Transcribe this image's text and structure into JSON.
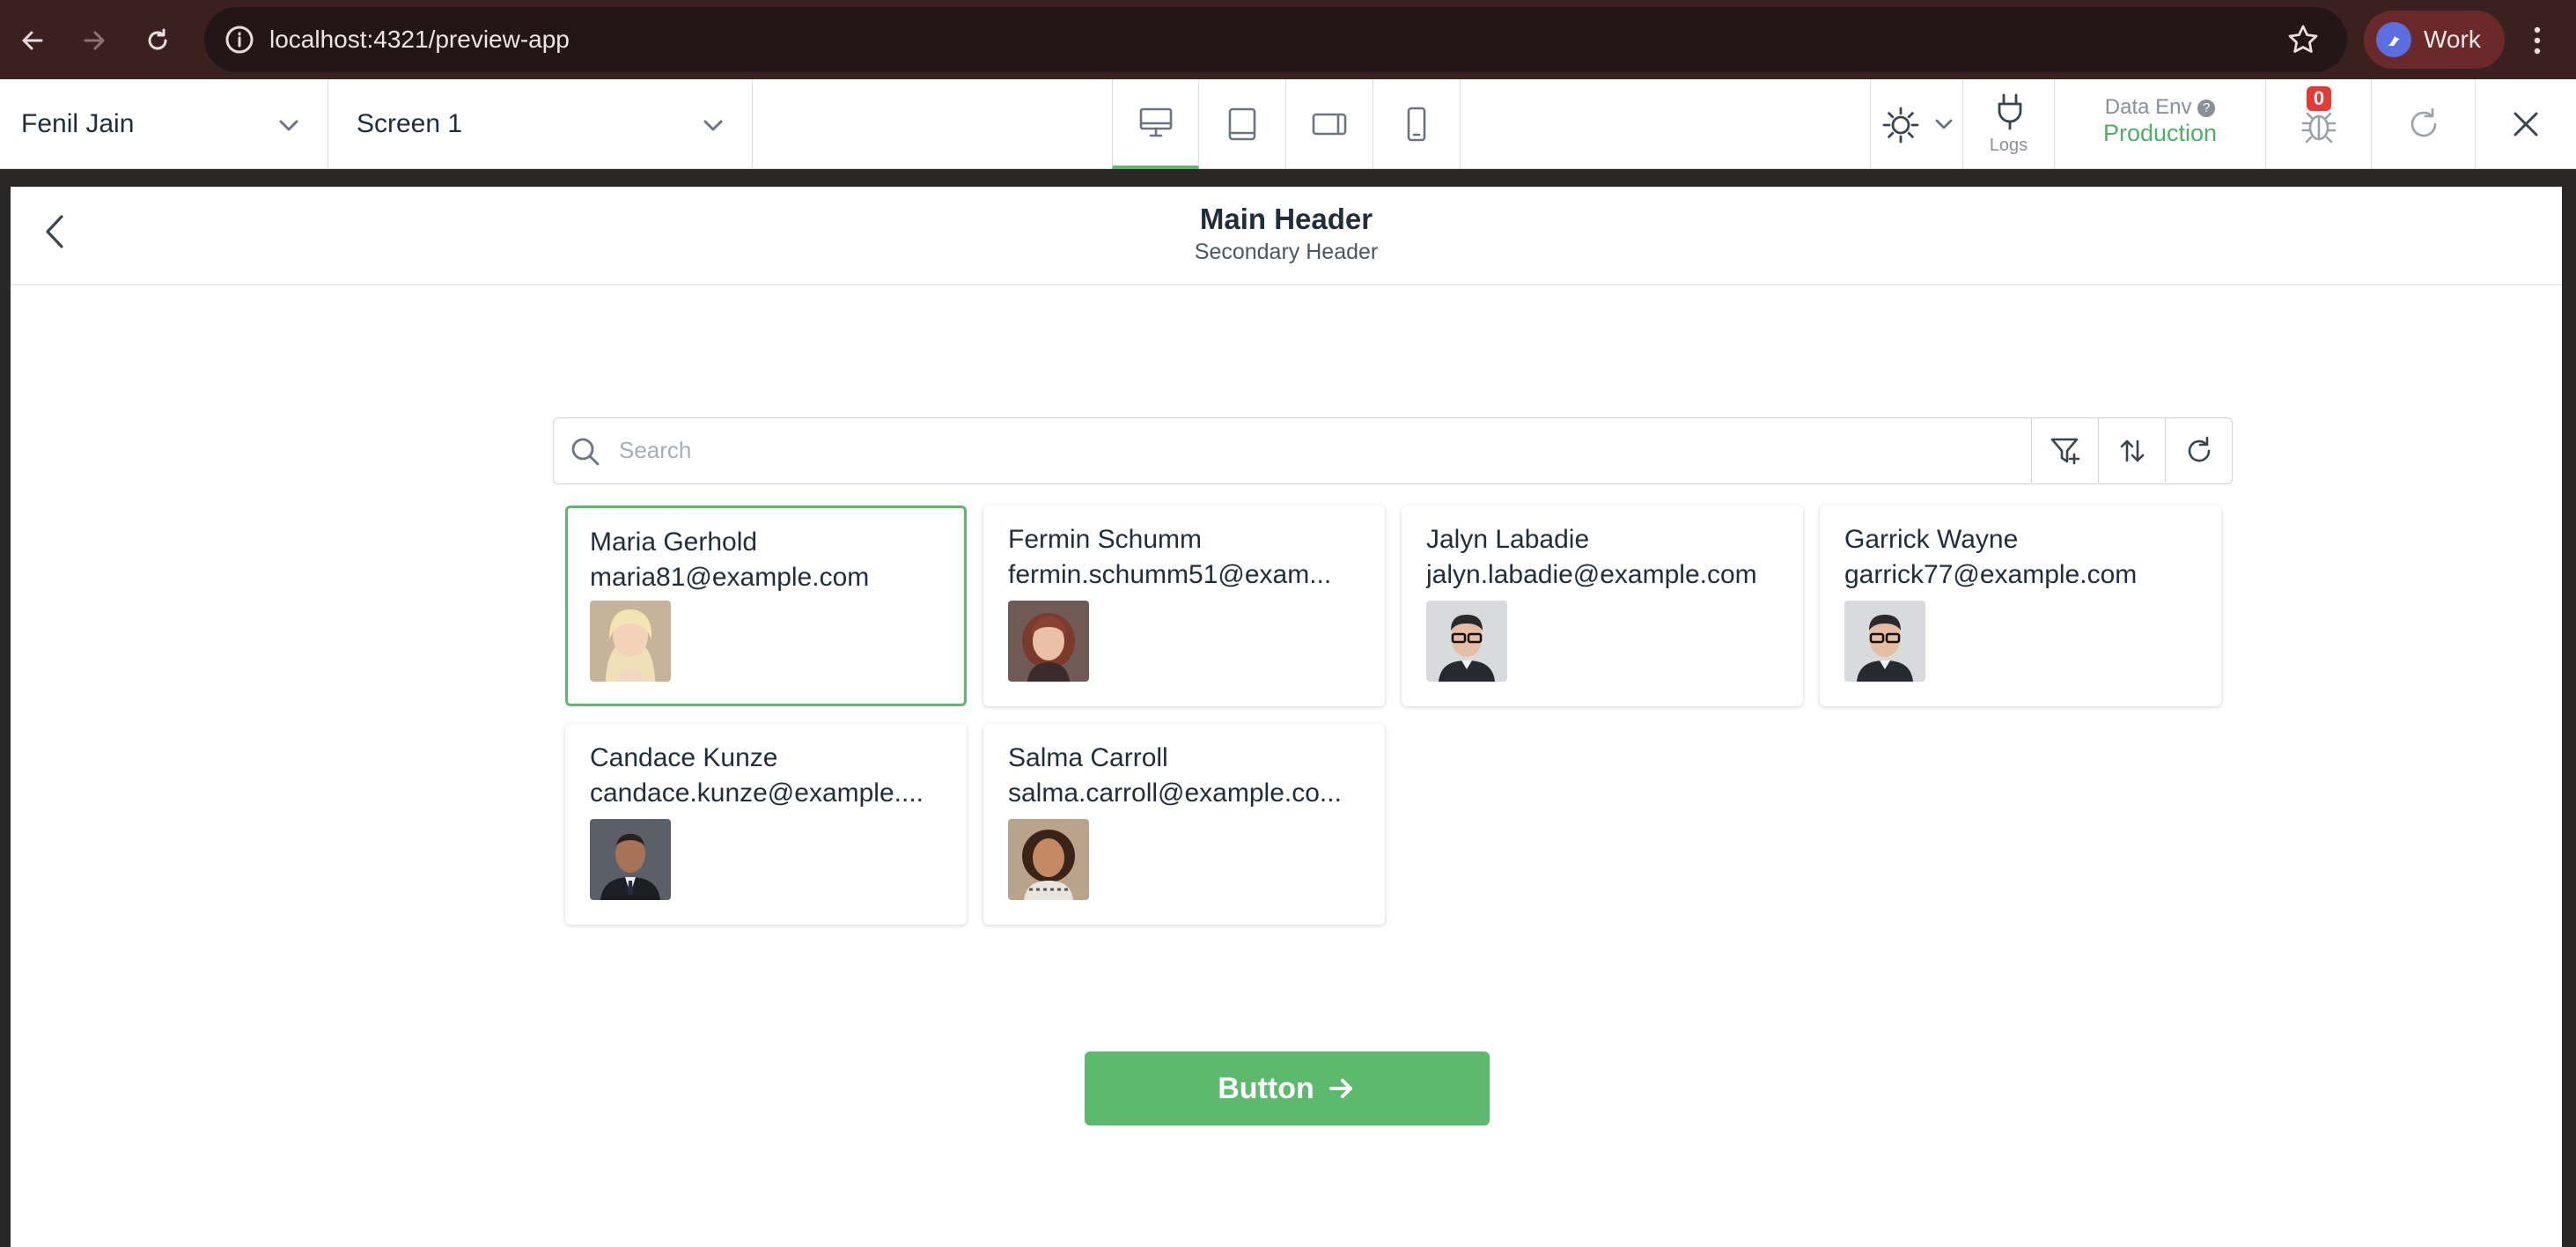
{
  "browser": {
    "url": "localhost:4321/preview-app",
    "profile_label": "Work"
  },
  "toolbar": {
    "user_select": "Fenil Jain",
    "screen_select": "Screen 1",
    "devices": [
      "desktop",
      "tablet",
      "tablet-landscape",
      "mobile"
    ],
    "active_device": "desktop",
    "logs_label": "Logs",
    "data_env_label": "Data Env",
    "data_env_value": "Production",
    "debug_badge": "0"
  },
  "app": {
    "main_header": "Main Header",
    "secondary_header": "Secondary Header",
    "search": {
      "placeholder": "Search",
      "value": ""
    },
    "cards": [
      {
        "name": "Maria Gerhold",
        "email": "maria81@example.com",
        "selected": true
      },
      {
        "name": "Fermin Schumm",
        "email": "fermin.schumm51@exam...",
        "selected": false
      },
      {
        "name": "Jalyn Labadie",
        "email": "jalyn.labadie@example.com",
        "selected": false
      },
      {
        "name": "Garrick Wayne",
        "email": "garrick77@example.com",
        "selected": false
      },
      {
        "name": "Candace Kunze",
        "email": "candace.kunze@example....",
        "selected": false
      },
      {
        "name": "Salma Carroll",
        "email": "salma.carroll@example.co...",
        "selected": false
      }
    ],
    "button_label": "Button"
  },
  "colors": {
    "accent": "#5cb96e",
    "browser_bg": "#3a2120",
    "badge": "#e53935"
  }
}
